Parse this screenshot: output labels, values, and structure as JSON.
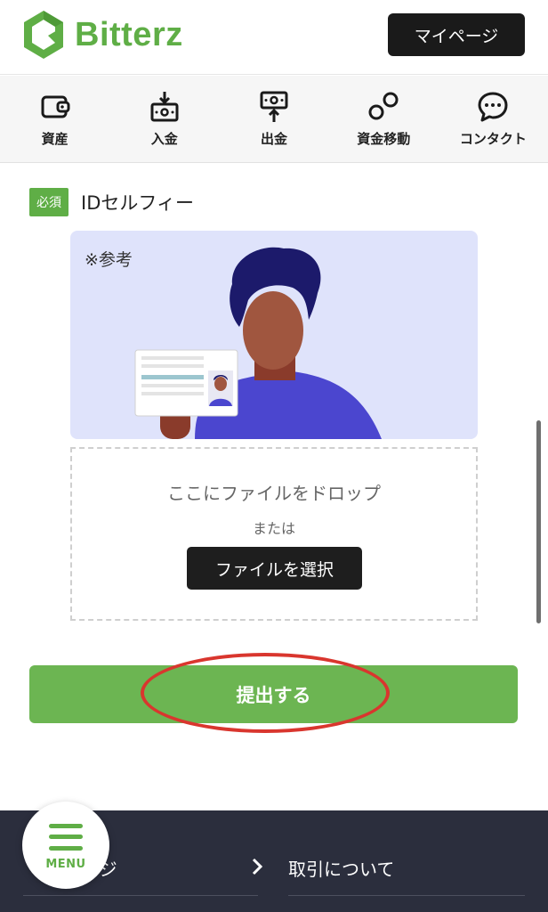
{
  "brand": {
    "name": "Bitterz",
    "color": "#5fae46",
    "logo_icon": "hexagon-logo-icon"
  },
  "header": {
    "mypage_label": "マイページ"
  },
  "nav": [
    {
      "label": "資産",
      "icon": "wallet-icon"
    },
    {
      "label": "入金",
      "icon": "deposit-icon"
    },
    {
      "label": "出金",
      "icon": "withdraw-icon"
    },
    {
      "label": "資金移動",
      "icon": "transfer-icon"
    },
    {
      "label": "コンタクト",
      "icon": "chat-icon"
    }
  ],
  "section": {
    "required_badge": "必須",
    "title": "IDセルフィー",
    "example_label": "※参考"
  },
  "dropzone": {
    "drop_text": "ここにファイルをドロップ",
    "or_text": "または",
    "choose_button": "ファイルを選択"
  },
  "submit_label": "提出する",
  "highlight_color": "#d9362e",
  "footer": {
    "link_left": "マイページ",
    "link_right": "取引について",
    "menu_label": "MENU"
  }
}
